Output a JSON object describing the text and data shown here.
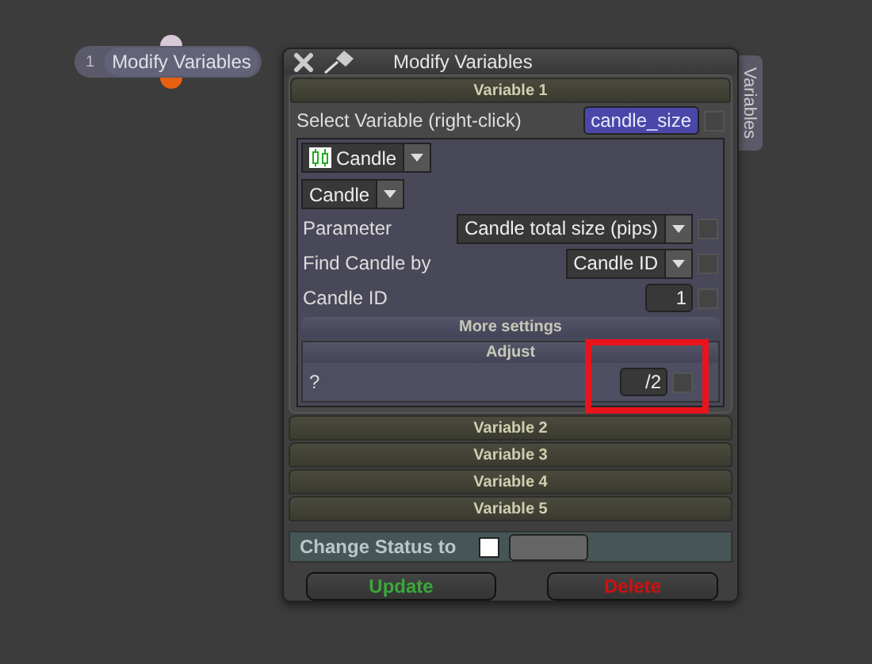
{
  "node": {
    "number": "1",
    "label": "Modify Variables"
  },
  "window": {
    "title": "Modify Variables",
    "side_tab": "Variables"
  },
  "variable_1": {
    "header": "Variable 1",
    "select_label": "Select Variable (right-click)",
    "variable_name": "candle_size",
    "variable_checked": false,
    "type_dropdown": "Candle",
    "sub_dropdown": "Candle",
    "params": [
      {
        "kind": "dropdown",
        "label": "Parameter",
        "value": "Candle total size (pips)",
        "checked": false
      },
      {
        "kind": "dropdown",
        "label": "Find Candle by",
        "value": "Candle ID",
        "checked": false
      },
      {
        "kind": "input",
        "label": "Candle ID",
        "value": "1",
        "checked": false
      }
    ],
    "more_settings": "More settings",
    "adjust": {
      "header": "Adjust",
      "label": "?",
      "value": "/2",
      "checked": false
    }
  },
  "variables": [
    "Variable 2",
    "Variable 3",
    "Variable 4",
    "Variable 5"
  ],
  "status": {
    "label": "Change Status to",
    "checked": false
  },
  "buttons": [
    {
      "label": "Update",
      "kind": "update"
    },
    {
      "label": "Delete",
      "kind": "delete"
    }
  ]
}
